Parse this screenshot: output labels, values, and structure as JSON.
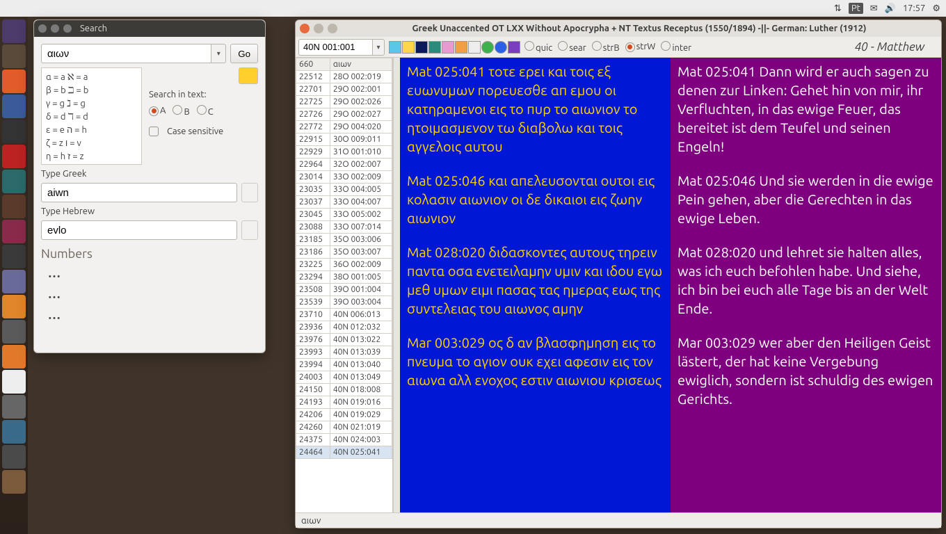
{
  "menubar": {
    "indicators": [
      "⇅",
      "Pt",
      "✉",
      "🔊"
    ],
    "time": "17:57",
    "gear": "⚙"
  },
  "search": {
    "title": "Search",
    "query": "αιων",
    "go_label": "Go",
    "charmap": [
      "α  =  a      ℵ  =  a",
      "β  =  b      ℶ  =  b",
      "γ  =  g      ℷ  =  g",
      "δ  =  d      ℸ  =  d",
      "ε  =  e      ה  =  h",
      "ζ  =  z      ו  =  v",
      "η  =  h      ז  =  z"
    ],
    "search_in_text_label": "Search in text:",
    "radios": {
      "a": "A",
      "b": "B",
      "c": "C",
      "selected": "a"
    },
    "case_label": "Case sensitive",
    "type_greek_label": "Type Greek",
    "type_greek_value": "aiwn",
    "type_hebrew_label": "Type Hebrew",
    "type_hebrew_value": "evlo",
    "numbers_label": "Numbers",
    "dots": [
      "…",
      "…",
      "…"
    ]
  },
  "main": {
    "title": "Greek Unaccented OT LXX Without Apocrypha + NT Textus Receptus (1550/1894)   -||-   German: Luther (1912)",
    "verse_ref": "40N 001:001",
    "radios": [
      {
        "id": "quic",
        "label": "quic",
        "sel": false
      },
      {
        "id": "sear",
        "label": "sear",
        "sel": false
      },
      {
        "id": "strB",
        "label": "strB",
        "sel": false
      },
      {
        "id": "strW",
        "label": "strW",
        "sel": true
      },
      {
        "id": "inter",
        "label": "inter",
        "sel": false
      }
    ],
    "book_title": "40 - Matthew",
    "concord_headers": [
      "660",
      "αιων"
    ],
    "concord_rows": [
      [
        "22512",
        "28O 002:019"
      ],
      [
        "22701",
        "29O 002:001"
      ],
      [
        "22725",
        "29O 002:026"
      ],
      [
        "22726",
        "29O 002:027"
      ],
      [
        "22772",
        "29O 004:020"
      ],
      [
        "22915",
        "30O 009:011"
      ],
      [
        "22929",
        "31O 001:010"
      ],
      [
        "22964",
        "32O 002:007"
      ],
      [
        "23014",
        "33O 002:009"
      ],
      [
        "23035",
        "33O 004:005"
      ],
      [
        "23037",
        "33O 004:007"
      ],
      [
        "23045",
        "33O 005:002"
      ],
      [
        "23088",
        "33O 007:014"
      ],
      [
        "23185",
        "35O 003:006"
      ],
      [
        "23186",
        "35O 003:007"
      ],
      [
        "23225",
        "36O 002:009"
      ],
      [
        "23294",
        "38O 001:005"
      ],
      [
        "23508",
        "39O 001:004"
      ],
      [
        "23539",
        "39O 003:004"
      ],
      [
        "23710",
        "40N 006:013"
      ],
      [
        "23936",
        "40N 012:032"
      ],
      [
        "23976",
        "40N 013:022"
      ],
      [
        "23993",
        "40N 013:039"
      ],
      [
        "23994",
        "40N 013:040"
      ],
      [
        "24003",
        "40N 013:049"
      ],
      [
        "24150",
        "40N 018:008"
      ],
      [
        "24193",
        "40N 019:016"
      ],
      [
        "24206",
        "40N 019:029"
      ],
      [
        "24260",
        "40N 021:019"
      ],
      [
        "24375",
        "40N 024:003"
      ],
      [
        "24464",
        "40N 025:041"
      ]
    ],
    "concord_selected": 30,
    "greek_verses": [
      "Mat 025:041 τοτε ερει και τοις εξ ευωνυμων πορευεσθε απ εμου οι κατηραμενοι εις το πυρ το αιωνιον το ητοιμασμενον τω διαβολω και τοις αγγελοις αυτου",
      "Mat 025:046 και απελευσονται ουτοι εις κολασιν αιωνιον οι δε δικαιοι εις ζωην αιωνιον",
      "Mat 028:020 διδασκοντες αυτους τηρειν παντα οσα ενετειλαμην υμιν και ιδου εγω μεθ υμων ειμι πασας τας ημερας εως της συντελειας του αιωνος αμην",
      "Mar 003:029 ος δ αν βλασφημηση εις το πνευμα το αγιον ουκ εχει αφεσιν εις τον αιωνα αλλ ενοχος εστιν αιωνιου κρισεως"
    ],
    "german_verses": [
      "Mat 025:041 Dann wird er auch sagen zu denen zur Linken: Gehet hin von mir, ihr Verfluchten, in das ewige Feuer, das bereitet ist dem Teufel und seinen Engeln!",
      "Mat 025:046 Und sie werden in die ewige Pein gehen, aber die Gerechten in das ewige Leben.",
      "Mat 028:020 und lehret sie halten alles, was ich euch befohlen habe. Und siehe, ich bin bei euch alle Tage bis an der Welt Ende.",
      "Mar 003:029 wer aber den Heiligen Geist lästert, der hat keine Vergebung ewiglich, sondern ist schuldig des ewigen Gerichts."
    ],
    "status": "αιων"
  }
}
